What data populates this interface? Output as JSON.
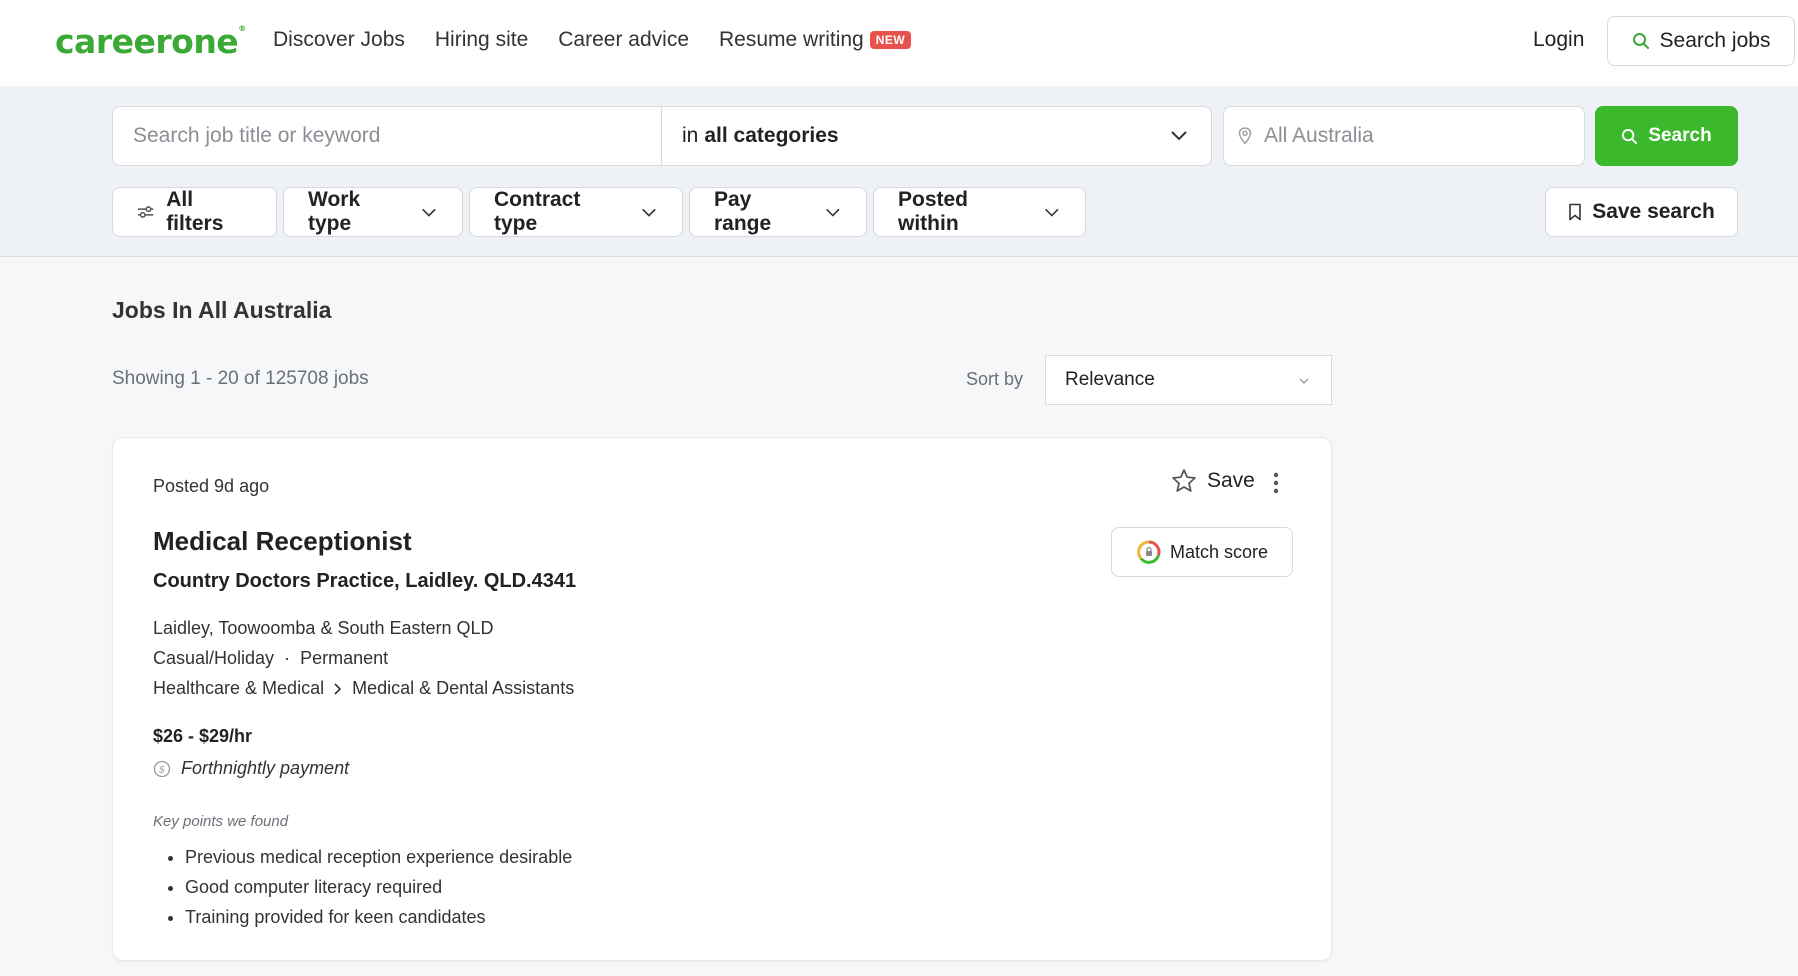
{
  "header": {
    "logo": "careerone",
    "nav": [
      {
        "label": "Discover Jobs"
      },
      {
        "label": "Hiring site"
      },
      {
        "label": "Career advice"
      },
      {
        "label": "Resume writing",
        "badge": "NEW"
      }
    ],
    "login": "Login",
    "search_jobs": "Search jobs"
  },
  "search": {
    "keyword_placeholder": "Search job title or keyword",
    "category_prefix": "in",
    "category_value": "all categories",
    "location_placeholder": "All Australia",
    "search_button": "Search"
  },
  "filters": {
    "all_filters": "All filters",
    "items": [
      "Work type",
      "Contract type",
      "Pay range",
      "Posted within"
    ],
    "save_search": "Save search"
  },
  "results": {
    "title": "Jobs In All Australia",
    "showing": "Showing 1 - 20 of 125708 jobs",
    "sort_label": "Sort by",
    "sort_value": "Relevance"
  },
  "job": {
    "posted": "Posted 9d ago",
    "save": "Save",
    "title": "Medical Receptionist",
    "company": "Country Doctors Practice, Laidley. QLD.4341",
    "match_score": "Match score",
    "location": "Laidley, Toowoomba & South Eastern QLD",
    "work_type": "Casual/Holiday",
    "contract_type": "Permanent",
    "category": "Healthcare & Medical",
    "subcategory": "Medical & Dental Assistants",
    "pay": "$26 - $29/hr",
    "pay_frequency": "Forthnightly payment",
    "key_points_label": "Key points we found",
    "key_points": [
      "Previous medical reception experience desirable",
      "Good computer literacy required",
      "Training provided for keen candidates"
    ]
  },
  "colors": {
    "brand_green": "#3aa935",
    "button_green": "#3bb82c",
    "new_badge": "#e8524d"
  }
}
